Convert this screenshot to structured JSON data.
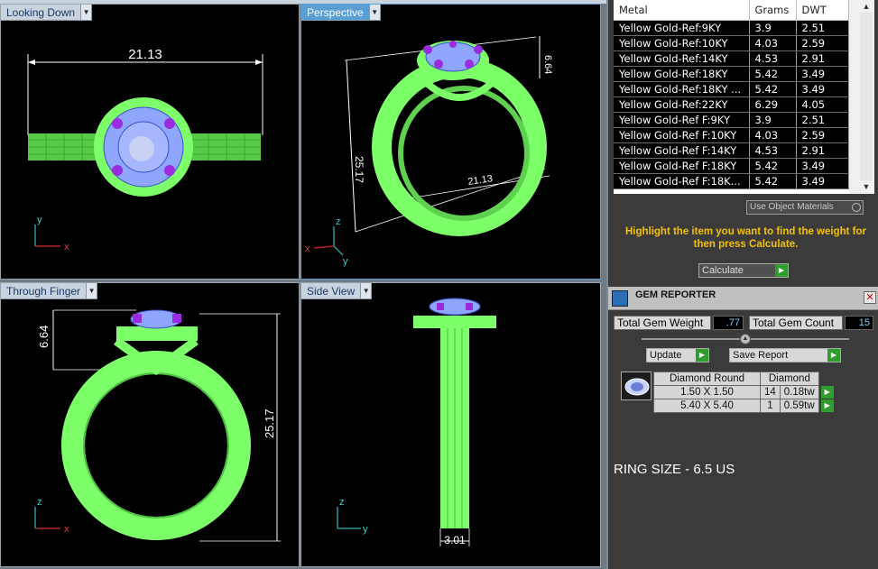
{
  "viewports": [
    {
      "id": "top-left",
      "label": "Looking Down",
      "dimension": "21.13",
      "axis1": "y",
      "axis2": "x",
      "active": false
    },
    {
      "id": "top-right",
      "label": "Perspective",
      "dimension_height": "25.17",
      "dimension_width": "21.13",
      "dimension_small": "6.64",
      "axis1": "z",
      "axis2": "x",
      "axis3": "y",
      "active": true
    },
    {
      "id": "bottom-left",
      "label": "Through Finger",
      "dimension_height": "25.17",
      "dimension_small": "6.64",
      "axis1": "z",
      "axis2": "x",
      "active": false
    },
    {
      "id": "bottom-right",
      "label": "Side View",
      "dimension": "3.01",
      "axis1": "z",
      "axis2": "y",
      "active": false
    }
  ],
  "metals": {
    "headers": [
      "Metal",
      "Grams",
      "DWT"
    ],
    "rows": [
      [
        "Yellow Gold-Ref:9KY",
        "3.9",
        "2.51"
      ],
      [
        "Yellow Gold-Ref:10KY",
        "4.03",
        "2.59"
      ],
      [
        "Yellow Gold-Ref:14KY",
        "4.53",
        "2.91"
      ],
      [
        "Yellow Gold-Ref:18KY",
        "5.42",
        "3.49"
      ],
      [
        "Yellow Gold-Ref:18KY ...",
        "5.42",
        "3.49"
      ],
      [
        "Yellow Gold-Ref:22KY",
        "6.29",
        "4.05"
      ],
      [
        "Yellow Gold-Ref F:9KY",
        "3.9",
        "2.51"
      ],
      [
        "Yellow Gold-Ref F:10KY",
        "4.03",
        "2.59"
      ],
      [
        "Yellow Gold-Ref F:14KY",
        "4.53",
        "2.91"
      ],
      [
        "Yellow Gold-Ref F:18KY",
        "5.42",
        "3.49"
      ],
      [
        "Yellow Gold-Ref F:18K...",
        "5.42",
        "3.49"
      ]
    ]
  },
  "controls": {
    "use_object_materials": "Use Object Materials",
    "hint": "Highlight the item you want to find the weight for then press Calculate.",
    "calculate": "Calculate"
  },
  "gem_reporter": {
    "title": "GEM REPORTER",
    "total_weight_label": "Total Gem Weight",
    "total_weight_value": ".77",
    "total_count_label": "Total Gem Count",
    "total_count_value": "15",
    "update": "Update",
    "save_report": "Save Report",
    "table_header_shape": "Diamond Round",
    "table_header_type": "Diamond",
    "rows": [
      {
        "size": "1.50 X 1.50",
        "count": "14",
        "weight": "0.18tw"
      },
      {
        "size": "5.40 X 5.40",
        "count": "1",
        "weight": "0.59tw"
      }
    ]
  },
  "ring_size": "RING SIZE - 6.5 US",
  "colors": {
    "wire_green": "#7dff6a",
    "gem_blue": "#8fa6ff",
    "accent_purple": "#9a2be0",
    "hint_yellow": "#f2c100"
  }
}
